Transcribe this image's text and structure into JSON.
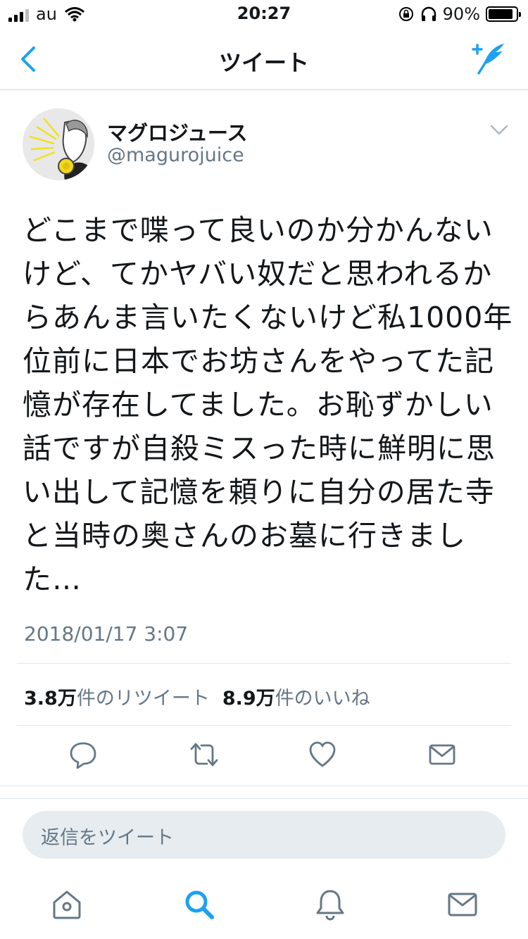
{
  "status": {
    "carrier": "au",
    "time": "20:27",
    "battery": "90%",
    "battery_level": 0.9
  },
  "nav": {
    "title": "ツイート",
    "back_icon": "chevron-left-icon",
    "compose_icon": "compose-tweet-icon"
  },
  "tweet": {
    "name": "マグロジュース",
    "handle": "@magurojuice",
    "text": "どこまで喋って良いのか分かんないけど、てかヤバい奴だと思われるからあんま言いたくないけど私1000年位前に日本でお坊さんをやってた記憶が存在してました。お恥ずかしい話ですが自殺ミスった時に鮮明に思い出して記憶を頼りに自分の居た寺と当時の奥さんのお墓に行きました…",
    "timestamp": "2018/01/17 3:07",
    "retweets": "3.8万",
    "retweets_label": "件のリツイート",
    "likes": "8.9万",
    "likes_label": "件のいいね"
  },
  "reply": {
    "placeholder": "返信をツイート"
  },
  "colors": {
    "accent": "#1da1f2",
    "icon_gray": "#657786",
    "divider": "#e1e8ed"
  }
}
